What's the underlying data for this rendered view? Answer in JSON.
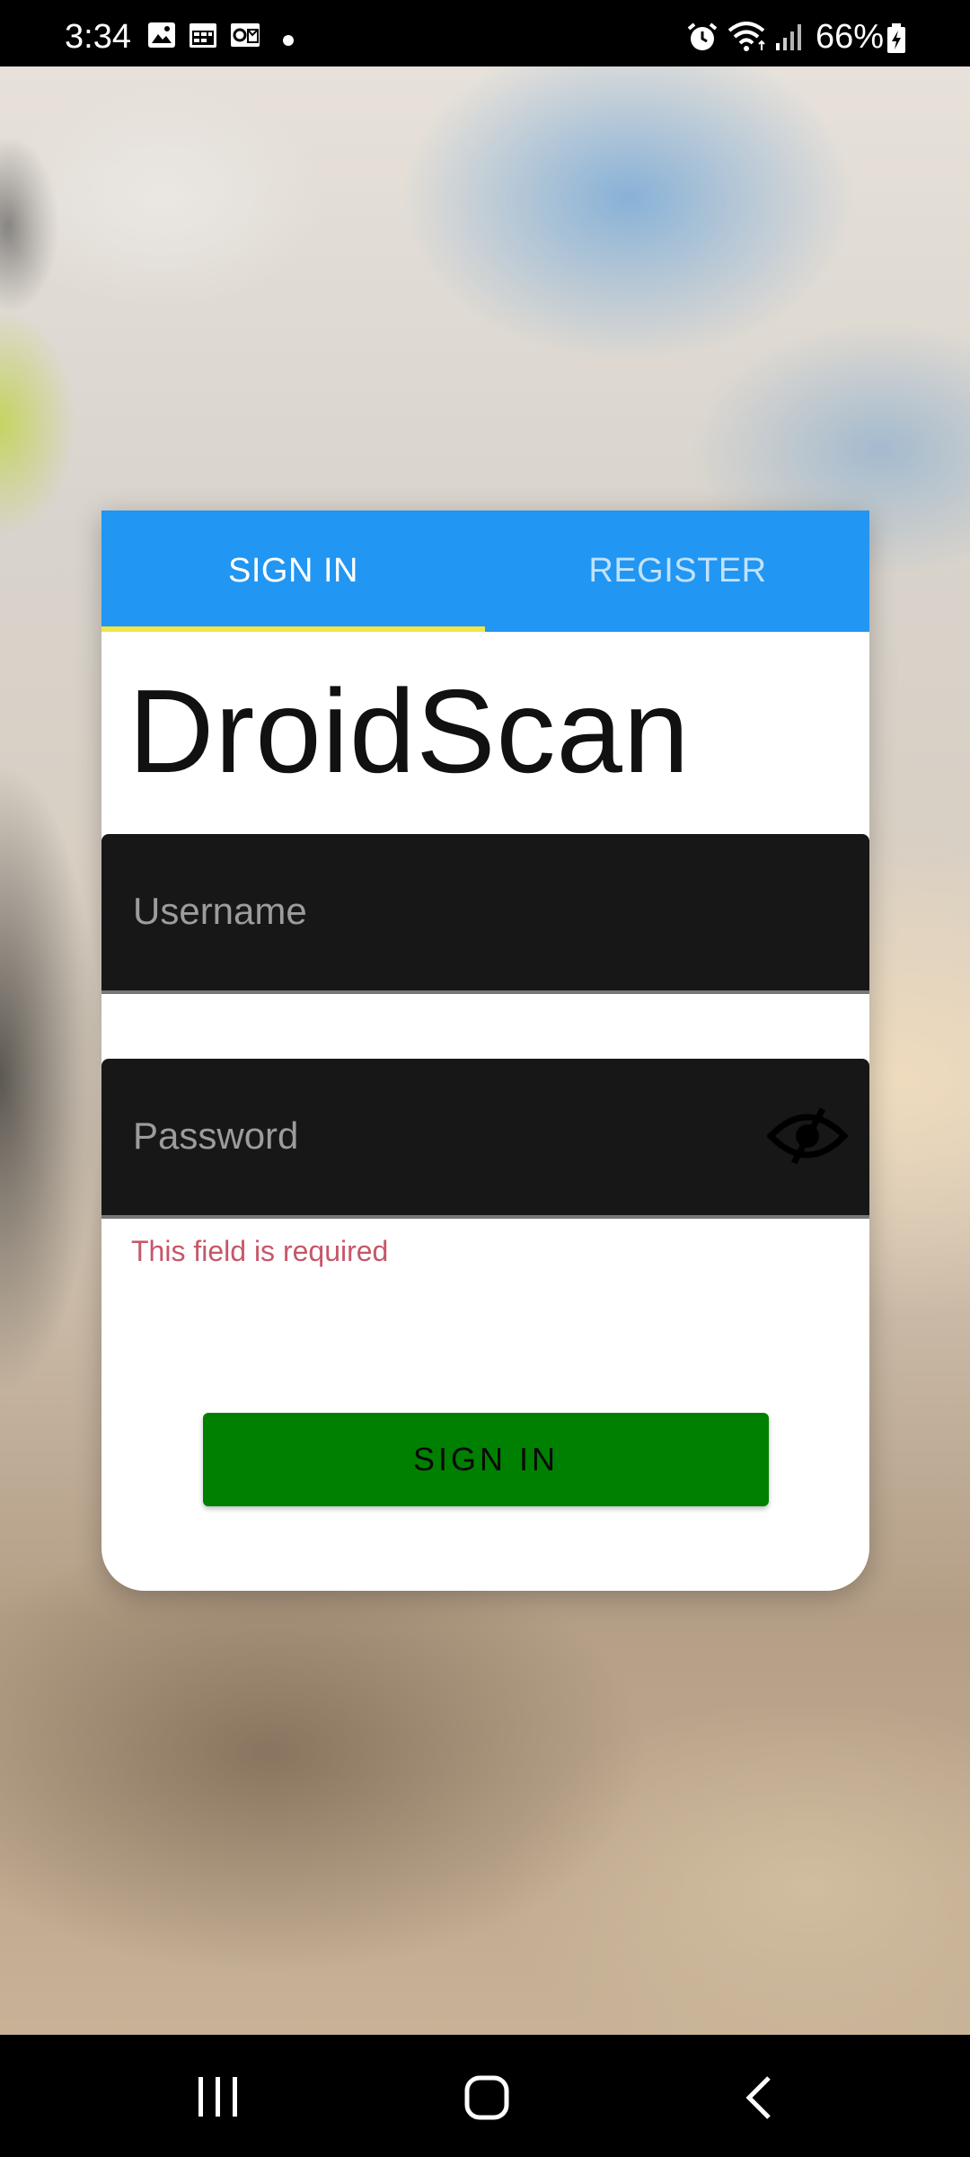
{
  "status_bar": {
    "time": "3:34",
    "battery": "66%",
    "icons": [
      "gallery-icon",
      "calendar-icon",
      "outlook-icon",
      "notification-dot-icon",
      "alarm-icon",
      "wifi-icon",
      "signal-icon",
      "battery-charging-icon"
    ]
  },
  "tabs": [
    {
      "label": "SIGN IN",
      "active": true
    },
    {
      "label": "REGISTER",
      "active": false
    }
  ],
  "app_title": "DroidScan",
  "username": {
    "placeholder": "Username",
    "value": ""
  },
  "password": {
    "placeholder": "Password",
    "value": "",
    "error": "This field is required",
    "visibility_icon": "eye-off-icon"
  },
  "sign_in_button": {
    "label": "SIGN IN"
  },
  "nav_bar": {
    "icons": [
      "recent-apps-icon",
      "home-icon",
      "back-icon"
    ]
  },
  "colors": {
    "tab_bar": "#2196f3",
    "tab_indicator": "#f0e64a",
    "field_background": "#171717",
    "error": "#c65769",
    "button": "#008000"
  }
}
